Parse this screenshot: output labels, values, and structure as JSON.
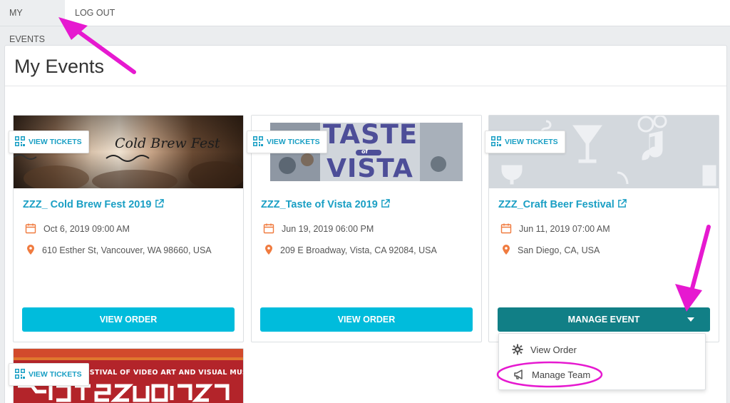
{
  "nav": {
    "tabs": [
      {
        "label": "MY EVENTS",
        "active": true
      },
      {
        "label": "LOG OUT",
        "active": false
      }
    ]
  },
  "page": {
    "title": "My Events"
  },
  "colors": {
    "accent": "#1a9fc4",
    "primary_button": "#00bcdc",
    "manage_button": "#117f86",
    "calendar_icon": "#f07b3f",
    "annotation": "#e619d0"
  },
  "events": [
    {
      "name": "ZZZ_ Cold Brew Fest 2019",
      "date": "Oct 6, 2019 09:00 AM",
      "location": "610 Esther St, Vancouver, WA 98660, USA",
      "view_tickets": "VIEW TICKETS",
      "action": "VIEW ORDER",
      "hero_logo": "Cold Brew Fest"
    },
    {
      "name": "ZZZ_Taste of Vista 2019",
      "date": "Jun 19, 2019 06:00 PM",
      "location": "209 E Broadway, Vista, CA 92084, USA",
      "view_tickets": "VIEW TICKETS",
      "action": "VIEW ORDER",
      "hero_logo": {
        "line1": "TASTE",
        "middle": "of",
        "line2": "VISTA"
      }
    },
    {
      "name": "ZZZ_Craft Beer Festival",
      "date": "Jun 11, 2019 07:00 AM",
      "location": "San Diego, CA, USA",
      "view_tickets": "VIEW TICKETS",
      "action": "MANAGE EVENT"
    },
    {
      "view_tickets": "VIEW TICKETS",
      "hero_banner": "ESTIVAL OF VIDEO ART AND VISUAL MUSIC"
    }
  ],
  "manage_menu": {
    "items": [
      {
        "label": "View Order",
        "icon": "gear-icon"
      },
      {
        "label": "Manage Team",
        "icon": "megaphone-icon"
      }
    ]
  }
}
